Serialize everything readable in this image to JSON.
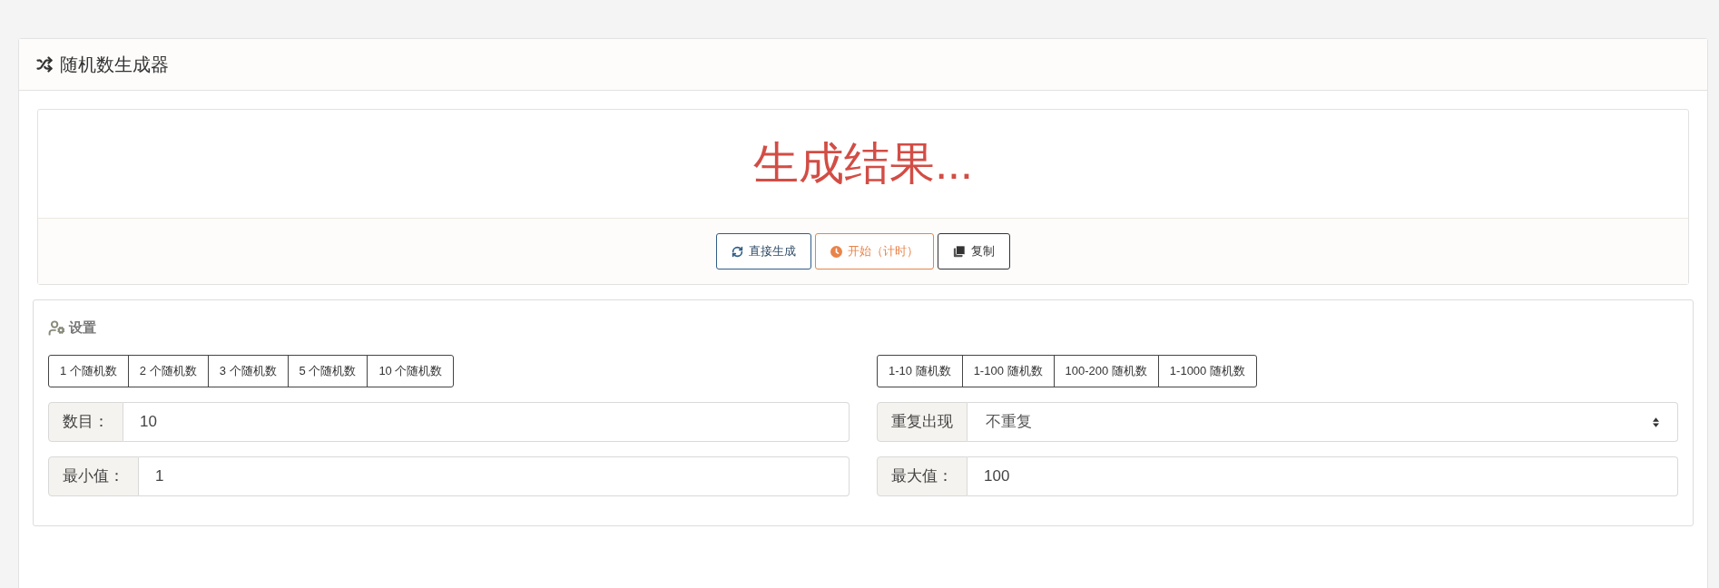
{
  "panel": {
    "title": "随机数生成器"
  },
  "result": {
    "text": "生成结果..."
  },
  "actions": [
    {
      "label": "直接生成",
      "kind": "generate"
    },
    {
      "label": "开始（计时）",
      "kind": "timer"
    },
    {
      "label": "复制",
      "kind": "copy"
    }
  ],
  "settings": {
    "title": "设置",
    "columns": [
      {
        "presets": [
          "1 个随机数",
          "2 个随机数",
          "3 个随机数",
          "5 个随机数",
          "10 个随机数"
        ],
        "fields": [
          {
            "label": "数目：",
            "value": "10",
            "kind": "input"
          },
          {
            "label": "最小值：",
            "value": "1",
            "kind": "input"
          }
        ]
      },
      {
        "presets": [
          "1-10 随机数",
          "1-100 随机数",
          "100-200 随机数",
          "1-1000 随机数"
        ],
        "fields": [
          {
            "label": "重复出现",
            "value": "不重复",
            "kind": "select"
          },
          {
            "label": "最大值：",
            "value": "100",
            "kind": "input"
          }
        ]
      }
    ]
  }
}
